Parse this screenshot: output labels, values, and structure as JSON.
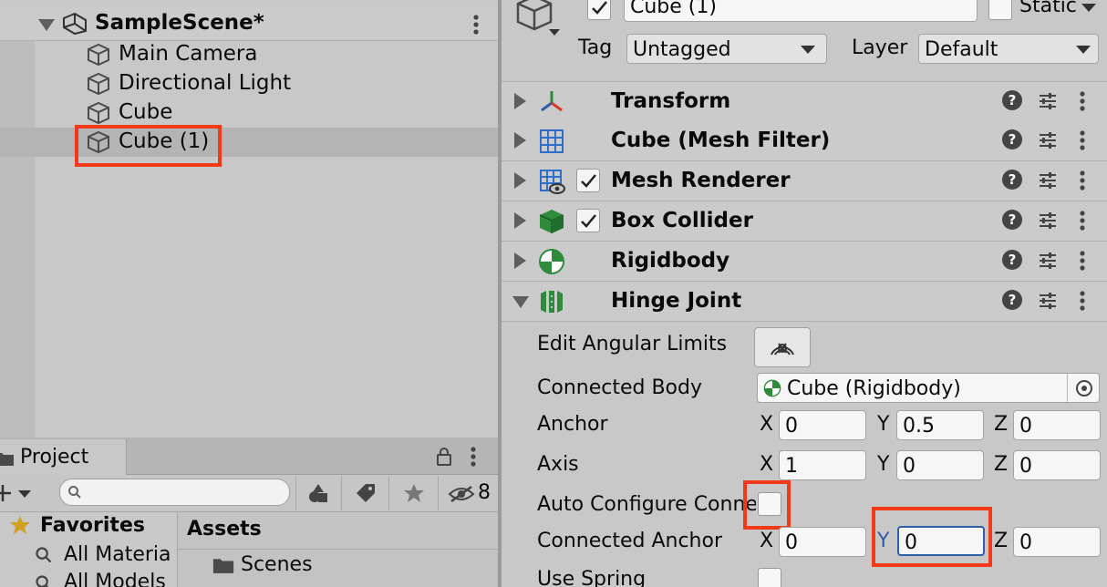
{
  "hierarchy": {
    "scene_name": "SampleScene*",
    "items": [
      {
        "label": "Main Camera"
      },
      {
        "label": "Directional Light"
      },
      {
        "label": "Cube"
      },
      {
        "label": "Cube (1)"
      }
    ]
  },
  "inspector": {
    "object_name": "Cube (1)",
    "static_label": "Static",
    "tag_label": "Tag",
    "tag_value": "Untagged",
    "layer_label": "Layer",
    "layer_value": "Default",
    "components": [
      {
        "name": "Transform",
        "icon": "transform-icon"
      },
      {
        "name": "Cube (Mesh Filter)",
        "icon": "mesh-filter-icon"
      },
      {
        "name": "Mesh Renderer",
        "icon": "mesh-renderer-icon"
      },
      {
        "name": "Box Collider",
        "icon": "box-collider-icon"
      },
      {
        "name": "Rigidbody",
        "icon": "rigidbody-icon"
      },
      {
        "name": "Hinge Joint",
        "icon": "hinge-joint-icon"
      }
    ],
    "help_glyph": "?",
    "hinge": {
      "edit_angular_limits": "Edit Angular Limits",
      "connected_body_label": "Connected Body",
      "connected_body_value": "Cube (Rigidbody)",
      "anchor_label": "Anchor",
      "anchor": {
        "x": "0",
        "y": "0.5",
        "z": "0"
      },
      "axis_label": "Axis",
      "axis": {
        "x": "1",
        "y": "0",
        "z": "0"
      },
      "auto_configure_label": "Auto Configure Conne",
      "connected_anchor_label": "Connected Anchor",
      "connected_anchor": {
        "x": "0",
        "y": "0",
        "z": "0"
      },
      "use_spring_label": "Use Spring",
      "x_label": "X",
      "y_label": "Y",
      "z_label": "Z"
    }
  },
  "project": {
    "tab_label": "Project",
    "hidden_count": "8",
    "favorites_label": "Favorites",
    "favorites_items": [
      {
        "label": "All Materia"
      },
      {
        "label": "All Models"
      }
    ],
    "assets_label": "Assets",
    "asset_items": [
      {
        "label": "Scenes"
      }
    ]
  },
  "colors": {
    "highlight": "#f23a1a",
    "focus_blue": "#2f5fa8",
    "component_green": "#2e8b3c"
  }
}
